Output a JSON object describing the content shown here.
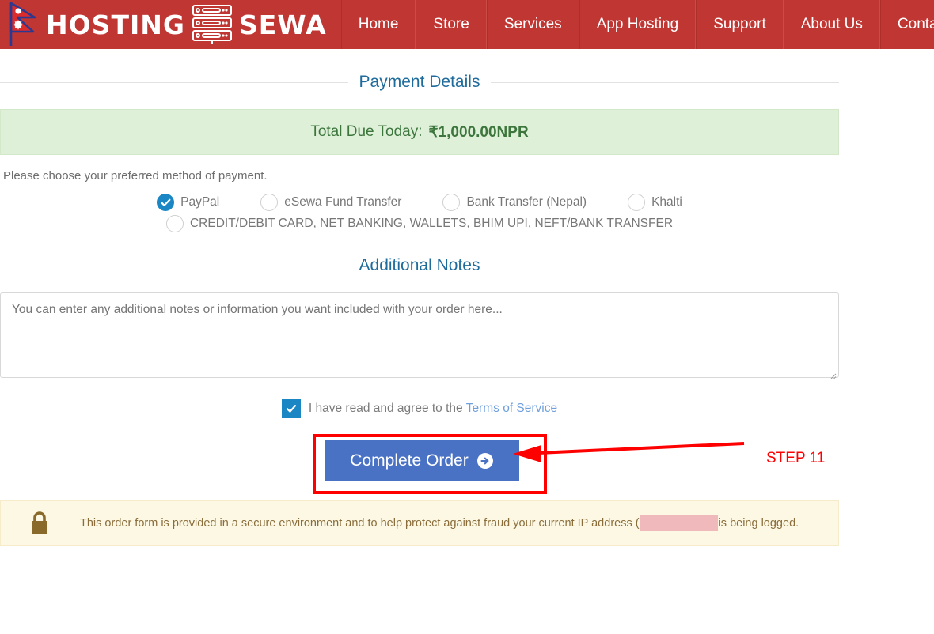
{
  "header": {
    "brand": {
      "word1": "HOSTING",
      "word2": "SEWA",
      "flag_icon": "nepal-flag-icon",
      "server_icon": "server-rack-icon"
    },
    "nav": [
      {
        "label": "Home"
      },
      {
        "label": "Store"
      },
      {
        "label": "Services"
      },
      {
        "label": "App Hosting"
      },
      {
        "label": "Support"
      },
      {
        "label": "About Us"
      },
      {
        "label": "Contact"
      }
    ],
    "brand_color": "#bf3633"
  },
  "payment": {
    "section_title": "Payment Details",
    "total_label": "Total Due Today:",
    "total_amount": "₹1,000.00NPR",
    "total_bg": "#dff0d8",
    "total_color": "#3c763d",
    "choose_text": "Please choose your preferred method of payment.",
    "methods_row1": [
      {
        "label": "PayPal",
        "checked": true
      },
      {
        "label": "eSewa Fund Transfer",
        "checked": false
      },
      {
        "label": "Bank Transfer (Nepal)",
        "checked": false
      },
      {
        "label": "Khalti",
        "checked": false
      }
    ],
    "methods_row2": [
      {
        "label": "CREDIT/DEBIT CARD, NET BANKING, WALLETS, BHIM UPI, NEFT/BANK TRANSFER",
        "checked": false
      }
    ]
  },
  "notes": {
    "section_title": "Additional Notes",
    "placeholder": "You can enter any additional notes or information you want included with your order here...",
    "value": ""
  },
  "terms": {
    "checked": true,
    "text": "I have read and agree to the ",
    "link_label": "Terms of Service"
  },
  "order": {
    "button_label": "Complete Order",
    "button_icon": "arrow-right-circle-icon",
    "button_color": "#4a72c4",
    "highlight_color": "#ff0000",
    "annotation_label": "STEP 11"
  },
  "secure": {
    "icon": "lock-icon",
    "text_before": "This order form is provided in a secure environment and to help protect against fraud your current IP address (",
    "text_after": " is being logged.",
    "bg": "#fcf8e3",
    "color": "#8a6d3b"
  }
}
